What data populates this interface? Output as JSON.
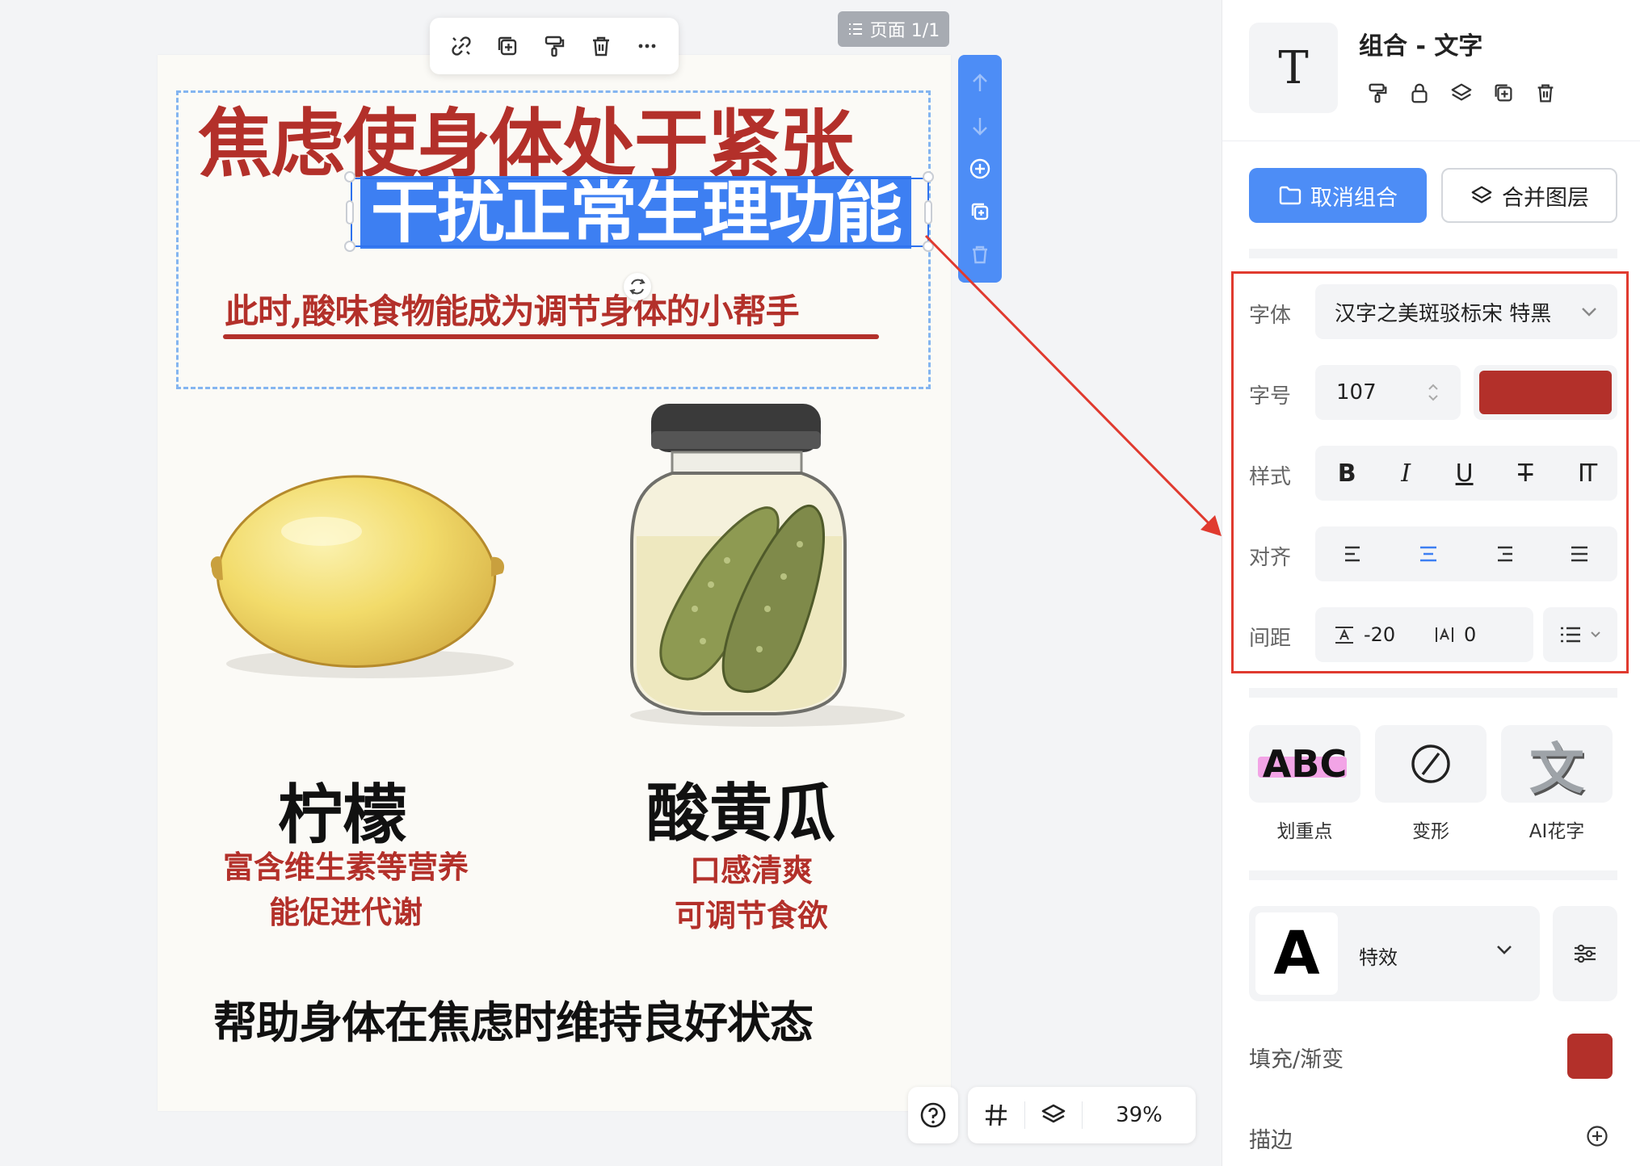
{
  "canvas": {
    "page_indicator": "页面 1/1",
    "zoom": "39%",
    "poster": {
      "headline_1": "焦虑使身体处于紧张",
      "headline_2": "干扰正常生理功能",
      "subtitle": "此时,酸味食物能成为调节身体的小帮手",
      "lemon_title": "柠檬",
      "lemon_desc_1": "富含维生素等营养",
      "lemon_desc_2": "能促进代谢",
      "pickle_title": "酸黄瓜",
      "pickle_desc_1": "口感清爽",
      "pickle_desc_2": "可调节食欲",
      "bottom_line": "帮助身体在焦虑时维持良好状态"
    },
    "floating_toolbar": [
      "unlink-icon",
      "duplicate-icon",
      "format-paint-icon",
      "delete-icon",
      "more-icon"
    ],
    "vertical_toolbar": [
      "arrow-up-icon",
      "arrow-down-icon",
      "add-circle-icon",
      "copy-icon",
      "trash-icon"
    ]
  },
  "panel": {
    "header_icon": "T",
    "title": "组合 - 文字",
    "ungroup_label": "取消组合",
    "merge_layers_label": "合并图层",
    "font_label": "字体",
    "font_value": "汉字之美斑驳标宋 特黑",
    "size_label": "字号",
    "size_value": "107",
    "text_color": "#b3302a",
    "style_label": "样式",
    "style_buttons": {
      "bold": "B",
      "italic": "I",
      "underline": "U",
      "strike": "T",
      "vertical": "IT"
    },
    "align_label": "对齐",
    "spacing_label": "间距",
    "letter_spacing": "-20",
    "line_spacing": "0",
    "effects": {
      "highlight": "划重点",
      "highlight_tile": "ABC",
      "transform": "变形",
      "ai_text": "AI花字",
      "ai_tile": "文"
    },
    "fx_preview": "A",
    "fx_label": "特效",
    "fill_label": "填充/渐变",
    "fill_color": "#b3302a",
    "stroke_label": "描边",
    "accent_color": "#4d8df6",
    "highlight_frame_color": "#e03a2f"
  }
}
